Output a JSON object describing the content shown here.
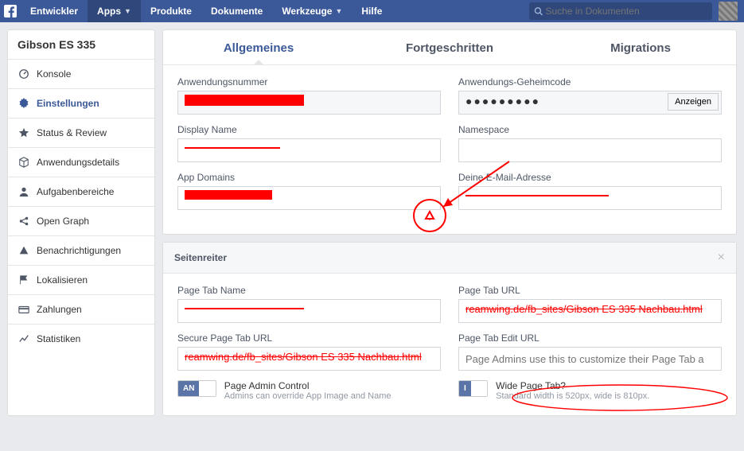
{
  "navbar": {
    "links": [
      "Entwickler",
      "Apps",
      "Produkte",
      "Dokumente",
      "Werkzeuge",
      "Hilfe"
    ],
    "search_placeholder": "Suche in Dokumenten"
  },
  "sidebar": {
    "app_title": "Gibson ES 335",
    "items": [
      {
        "label": "Konsole"
      },
      {
        "label": "Einstellungen"
      },
      {
        "label": "Status & Review"
      },
      {
        "label": "Anwendungsdetails"
      },
      {
        "label": "Aufgabenbereiche"
      },
      {
        "label": "Open Graph"
      },
      {
        "label": "Benachrichtigungen"
      },
      {
        "label": "Lokalisieren"
      },
      {
        "label": "Zahlungen"
      },
      {
        "label": "Statistiken"
      }
    ]
  },
  "tabs": [
    "Allgemeines",
    "Fortgeschritten",
    "Migrations"
  ],
  "general": {
    "app_id_label": "Anwendungsnummer",
    "app_secret_label": "Anwendungs-Geheimcode",
    "app_secret_value": "●●●●●●●●●",
    "show_button": "Anzeigen",
    "display_name_label": "Display Name",
    "namespace_label": "Namespace",
    "app_domains_label": "App Domains",
    "email_label": "Deine E-Mail-Adresse"
  },
  "pagetab": {
    "section_title": "Seitenreiter",
    "name_label": "Page Tab Name",
    "url_label": "Page Tab URL",
    "secure_url_label": "Secure Page Tab URL",
    "edit_url_label": "Page Tab Edit URL",
    "edit_url_value": "Page Admins use this to customize their Page Tab a",
    "admin_control_title": "Page Admin Control",
    "admin_control_sub": "Admins can override App Image and Name",
    "admin_toggle_on": "AN",
    "wide_title": "Wide Page Tab?",
    "wide_sub": "Standard width is 520px, wide is 810px.",
    "wide_toggle_on": "I",
    "redacted_url": "reamwing.de/fb_sites/Gibson ES 335 Nachbau.html"
  }
}
